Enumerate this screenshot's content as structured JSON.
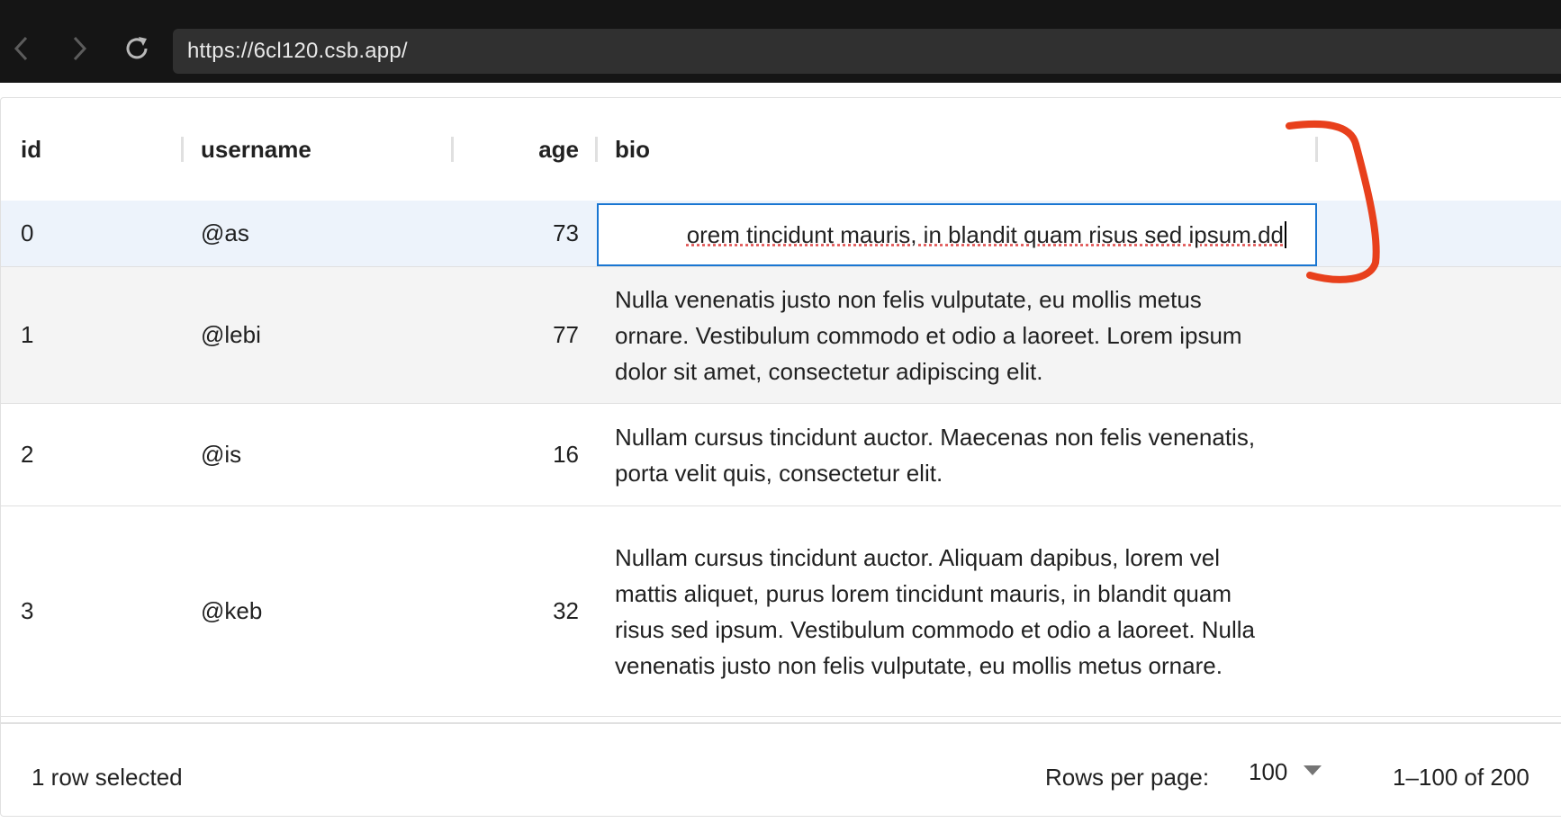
{
  "browser": {
    "url": "https://6cl120.csb.app/"
  },
  "grid": {
    "columns": [
      {
        "label": "id"
      },
      {
        "label": "username"
      },
      {
        "label": "age"
      },
      {
        "label": "bio"
      }
    ],
    "rows": [
      {
        "id": "0",
        "username": "@as",
        "age": "73",
        "bio": "orem tincidunt mauris, in blandit quam risus sed ipsum.dd",
        "editing": true,
        "selected": true
      },
      {
        "id": "1",
        "username": "@lebi",
        "age": "77",
        "bio": "Nulla venenatis justo non felis vulputate, eu mollis metus ornare. Vestibulum commodo et odio a laoreet. Lorem ipsum dolor sit amet, consectetur adipiscing elit."
      },
      {
        "id": "2",
        "username": "@is",
        "age": "16",
        "bio": "Nullam cursus tincidunt auctor. Maecenas non felis venenatis, porta velit quis, consectetur elit."
      },
      {
        "id": "3",
        "username": "@keb",
        "age": "32",
        "bio": "Nullam cursus tincidunt auctor. Aliquam dapibus, lorem vel mattis aliquet, purus lorem tincidunt mauris, in blandit quam risus sed ipsum. Vestibulum commodo et odio a laoreet. Nulla venenatis justo non felis vulputate, eu mollis metus ornare."
      }
    ]
  },
  "footer": {
    "selection_text": "1 row selected",
    "rows_per_page_label": "Rows per page:",
    "rows_per_page_value": "100",
    "pagination_text": "1–100 of 200"
  },
  "colors": {
    "selected_row_bg": "#edf3fb",
    "hover_row_bg": "#f4f4f4",
    "edit_border": "#1976d2",
    "annotation_stroke": "#e8401c"
  },
  "icons": {
    "back": "chevron-left-icon",
    "forward": "chevron-right-icon",
    "reload": "reload-icon",
    "dropdown": "caret-down-icon"
  }
}
